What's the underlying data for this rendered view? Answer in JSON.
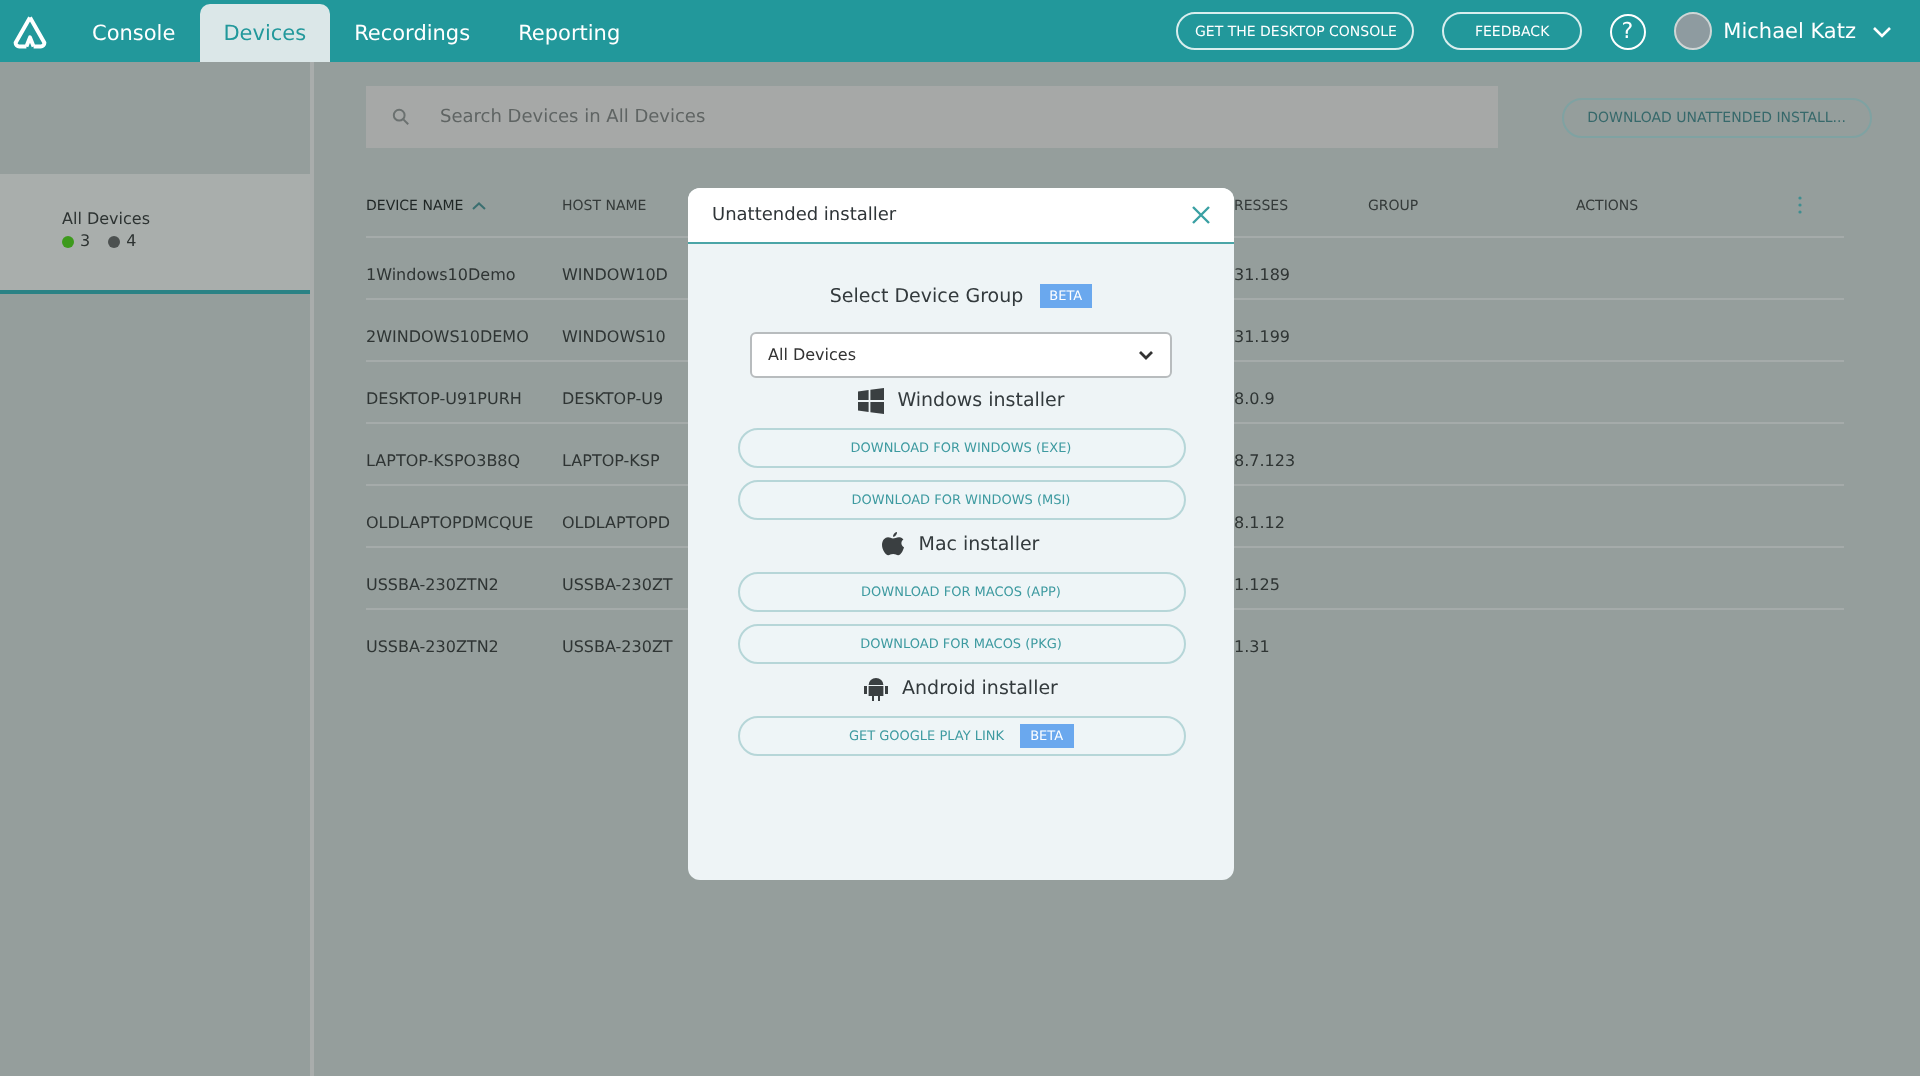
{
  "nav": {
    "tabs": [
      {
        "label": "Console",
        "selected": false
      },
      {
        "label": "Devices",
        "selected": true
      },
      {
        "label": "Recordings",
        "selected": false
      },
      {
        "label": "Reporting",
        "selected": false
      }
    ],
    "buttons": [
      "GET THE DESKTOP CONSOLE",
      "FEEDBACK"
    ],
    "help": "?",
    "user": "Michael Katz"
  },
  "sidebar": {
    "items": [
      {
        "label": "All Devices",
        "selected": true,
        "online": "3",
        "offline": "4"
      }
    ]
  },
  "search": {
    "placeholder": "Search Devices in All Devices"
  },
  "download_button": "DOWNLOAD UNATTENDED INSTALL...",
  "table": {
    "columns": [
      {
        "label": "DEVICE NAME",
        "sorted": true
      },
      {
        "label": "HOST NAME",
        "sorted": false
      },
      {
        "label": "RESSES",
        "sorted": false
      },
      {
        "label": "GROUP",
        "sorted": false
      },
      {
        "label": "ACTIONS",
        "sorted": false
      }
    ],
    "rows": [
      [
        "1Windows10Demo",
        "WINDOW10D",
        "31.189"
      ],
      [
        "2WINDOWS10DEMO",
        "WINDOWS10",
        "31.199"
      ],
      [
        "DESKTOP-U91PURH",
        "DESKTOP-U9",
        "8.0.9"
      ],
      [
        "LAPTOP-KSPO3B8Q",
        "LAPTOP-KSP",
        "8.7.123"
      ],
      [
        "OLDLAPTOPDMCQUE",
        "OLDLAPTOPD",
        "8.1.12"
      ],
      [
        "USSBA-230ZTN2",
        "USSBA-230ZT",
        "1.125"
      ],
      [
        "USSBA-230ZTN2",
        "USSBA-230ZT",
        "1.31"
      ]
    ]
  },
  "dialog": {
    "title": "Unattended installer",
    "group_label": "Select Device Group",
    "group_badge": "BETA",
    "group_value": "All Devices",
    "sections": [
      {
        "kind": "windows",
        "title": "Windows installer",
        "buttons": [
          {
            "label": "DOWNLOAD FOR WINDOWS (EXE)"
          },
          {
            "label": "DOWNLOAD FOR WINDOWS (MSI)"
          }
        ]
      },
      {
        "kind": "mac",
        "title": "Mac installer",
        "buttons": [
          {
            "label": "DOWNLOAD FOR MACOS (APP)"
          },
          {
            "label": "DOWNLOAD FOR MACOS (PKG)"
          }
        ]
      },
      {
        "kind": "android",
        "title": "Android installer",
        "buttons": [
          {
            "label": "GET GOOGLE PLAY LINK",
            "badge": "BETA"
          }
        ]
      }
    ]
  }
}
